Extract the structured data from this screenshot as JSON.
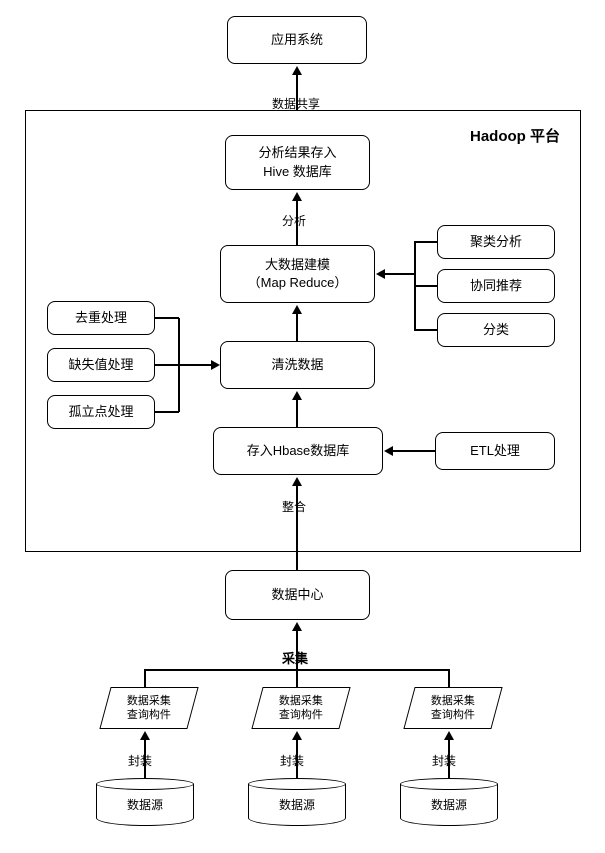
{
  "app_system": "应用系统",
  "data_share": "数据共享",
  "platform_label": "Hadoop 平台",
  "hive_box": "分析结果存入\nHive 数据库",
  "analyze": "分析",
  "modeling": "大数据建模\n（Map Reduce）",
  "clean": "清洗数据",
  "hbase": "存入Hbase数据库",
  "integrate": "整合",
  "dedup": "去重处理",
  "missing": "缺失值处理",
  "outlier": "孤立点处理",
  "cluster": "聚类分析",
  "recommend": "协同推荐",
  "classify": "分类",
  "etl": "ETL处理",
  "data_center": "数据中心",
  "collect": "采集",
  "collector": "数据采集\n查询构件",
  "encapsulate": "封装",
  "data_source": "数据源"
}
